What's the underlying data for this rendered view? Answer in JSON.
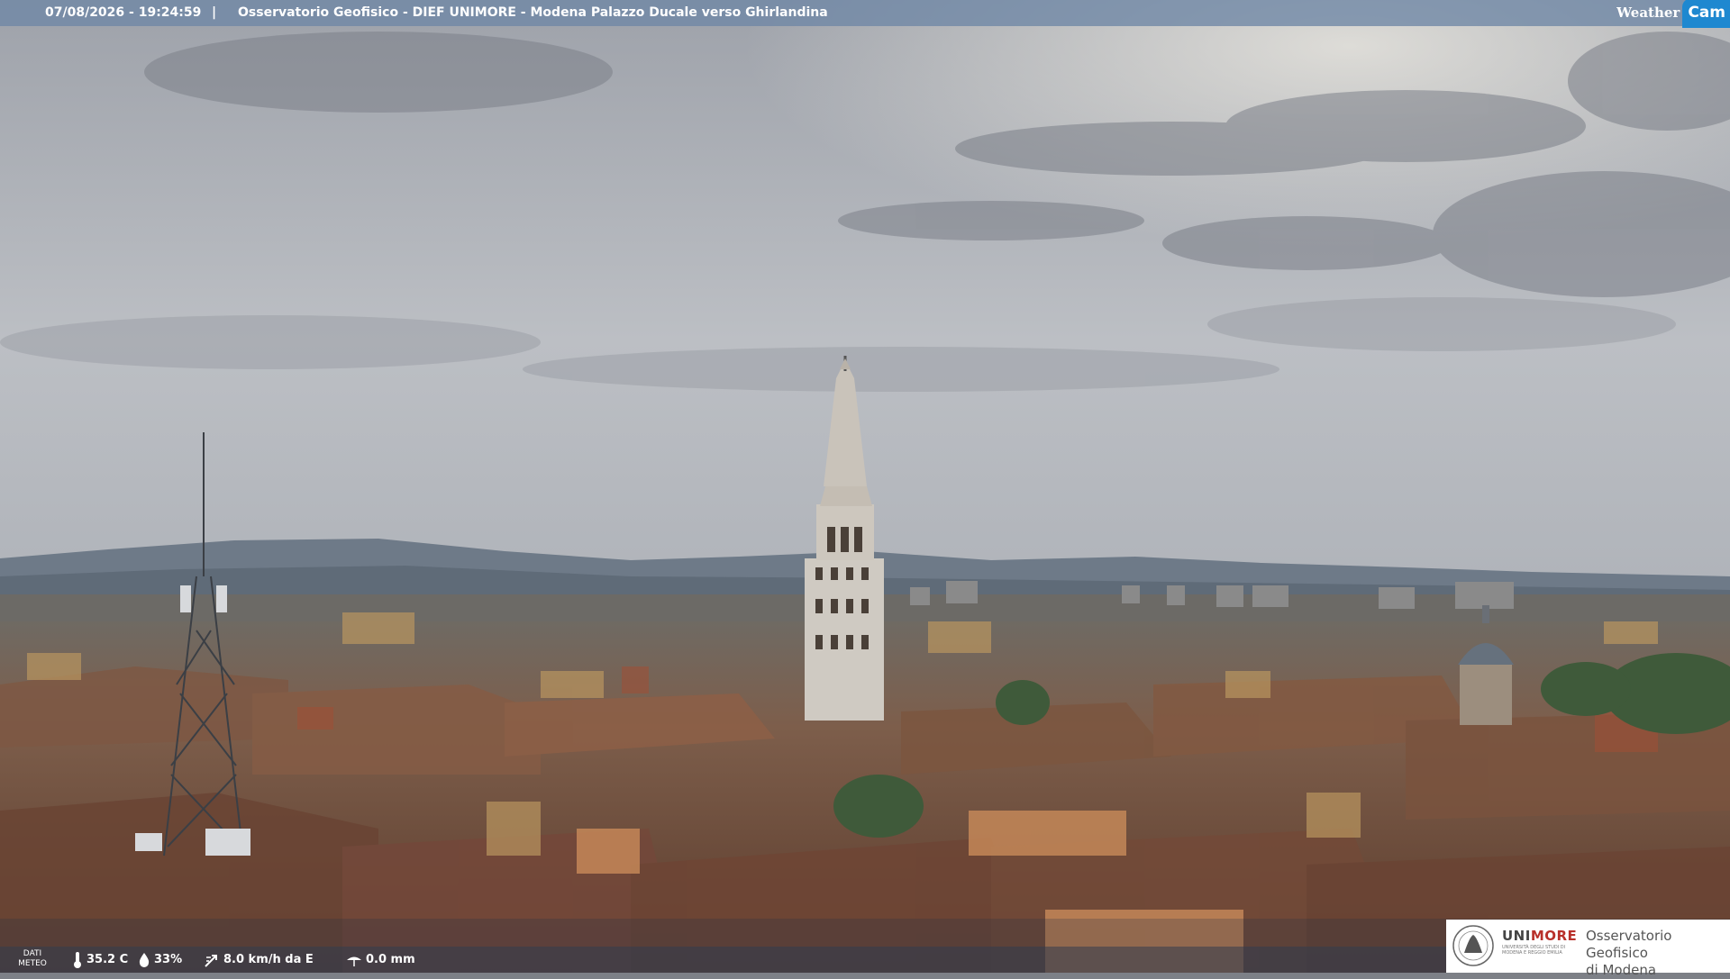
{
  "overlay": {
    "timestamp": "07/08/2026 - 19:24:59",
    "separator": "|",
    "title": "Osservatorio Geofisico - DIEF UNIMORE - Modena Palazzo Ducale verso Ghirlandina"
  },
  "brand": {
    "weather": "Weather",
    "cam": "Cam"
  },
  "meteo": {
    "label_line1": "DATI",
    "label_line2": "METEO",
    "temperature": "35.2 C",
    "humidity": "33%",
    "wind": "8.0 km/h da E",
    "rain": "0.0 mm",
    "icons": [
      "thermometer-icon",
      "humidity-drop-icon",
      "wind-icon",
      "rain-gauge-icon"
    ]
  },
  "logo": {
    "uni_prefix": "UNI",
    "uni_suffix": "MORE",
    "uni_sub": "Università degli Studi di Modena e Reggio Emilia",
    "obs_line1": "Osservatorio Geofisico",
    "obs_line2": "di Modena"
  },
  "colors": {
    "overlay_bar": "#6e87a5",
    "cam_badge": "#1e88d0",
    "unimore_red": "#b8302a",
    "sky": "#b9bcc1",
    "roofs": "#7a5340"
  }
}
